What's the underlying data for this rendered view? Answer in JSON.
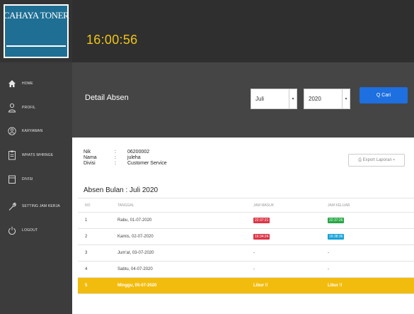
{
  "app": {
    "logo": "CAHAYA TONER",
    "clock": "16:00:56"
  },
  "sidebar": {
    "items": [
      {
        "label": "HOME",
        "icon": "home-icon"
      },
      {
        "label": "PROFIL",
        "icon": "user-icon"
      },
      {
        "label": "KARYAWAN",
        "icon": "users-icon"
      },
      {
        "label": "WHATS WHRNGE",
        "icon": "clipboard-icon"
      },
      {
        "label": "DIVISI",
        "icon": "folder-icon"
      },
      {
        "label": "SETTING JAM KERJA",
        "icon": "wrench-icon"
      },
      {
        "label": "LOGOUT",
        "icon": "power-icon"
      }
    ]
  },
  "header": {
    "title": "Detail Absen",
    "month": "Juli",
    "year": "2020",
    "search_label": "Q Cari"
  },
  "employee": {
    "nik_label": "Nik",
    "nik": "06200002",
    "nama_label": "Nama",
    "nama": "juleha",
    "divisi_label": "Divisi",
    "divisi": "Customer Service",
    "colon": ":"
  },
  "export_label": "⎙ Export Laporan ▾",
  "absen_title": "Absen Bulan : Juli 2020",
  "table": {
    "headers": [
      "NO",
      "TANGGAL",
      "JAM MASUK",
      "JAM KELUAR"
    ],
    "rows": [
      {
        "no": "1",
        "tanggal": "Rabu, 01-07-2020",
        "masuk": "22:37:21",
        "keluar": "22:37:26"
      },
      {
        "no": "2",
        "tanggal": "Kamis, 02-07-2020",
        "masuk": "16:34:24",
        "keluar": "16:38:36"
      },
      {
        "no": "3",
        "tanggal": "Jum'at, 03-07-2020",
        "masuk": "-",
        "keluar": "-"
      },
      {
        "no": "4",
        "tanggal": "Sabtu, 04-07-2020",
        "masuk": "-",
        "keluar": "-"
      },
      {
        "no": "5",
        "tanggal": "Minggu, 05-07-2020",
        "masuk": "Libur !!",
        "keluar": "Libur !!"
      }
    ]
  },
  "colors": {
    "accent": "#f0c419",
    "primary": "#1e6fe0",
    "holiday": "#f2bc0f",
    "late": "#dc3545",
    "ok": "#28a745",
    "info": "#17a2d8"
  }
}
